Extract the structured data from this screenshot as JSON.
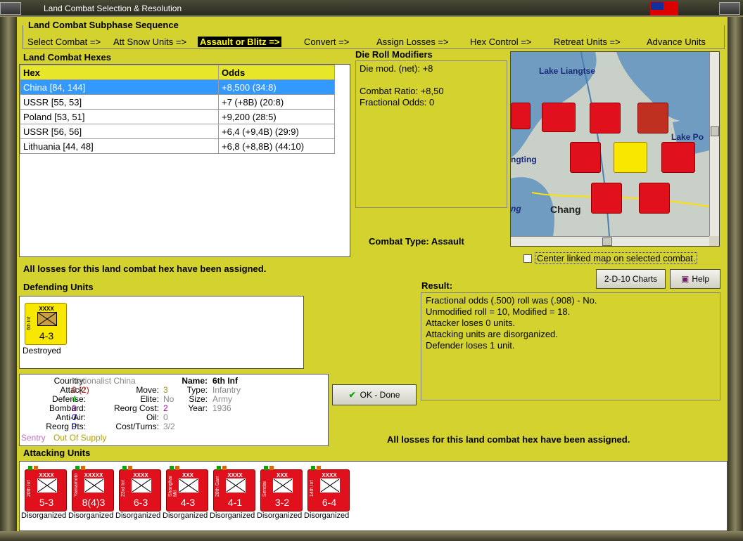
{
  "window": {
    "title": "Land Combat Selection & Resolution"
  },
  "phase": {
    "heading": "Land Combat Subphase Sequence",
    "steps": [
      "Select Combat =>",
      "Att Snow Units =>",
      "Assault or Blitz =>",
      "Convert =>",
      "Assign Losses =>",
      "Hex Control =>",
      "Retreat Units =>",
      "Advance Units"
    ]
  },
  "hexes": {
    "heading": "Land Combat Hexes",
    "col_hex": "Hex",
    "col_odds": "Odds",
    "rows": [
      {
        "hex": "China [84, 144]",
        "odds": "+8,500 (34:8)"
      },
      {
        "hex": "USSR [55, 53]",
        "odds": "+7 (+8B) (20:8)"
      },
      {
        "hex": "Poland [53, 51]",
        "odds": "+9,200 (28:5)"
      },
      {
        "hex": "USSR [56, 56]",
        "odds": "+6,4 (+9,4B) (29:9)"
      },
      {
        "hex": "Lithuania [44, 48]",
        "odds": "+6,8 (+8,8B) (44:10)"
      }
    ]
  },
  "modifiers": {
    "heading": "Die Roll Modifiers",
    "lines": [
      "Die mod. (net): +8",
      "",
      "Combat Ratio: +8,50",
      "Fractional Odds: 0"
    ]
  },
  "map": {
    "labels": [
      "Lake Liangtse",
      "Lake Po",
      "ngting",
      "Chang",
      "ng"
    ],
    "center_label": "Center linked map on selected combat."
  },
  "combat_type": {
    "label": "Combat Type:",
    "value": "Assault"
  },
  "messages": {
    "losses_assigned": "All losses for this land combat hex have been assigned."
  },
  "buttons": {
    "charts": "2-D-10 Charts",
    "help": "Help",
    "ok": "OK - Done"
  },
  "result": {
    "heading": "Result:",
    "lines": [
      "Fractional odds (.500) roll was (.908)  -  No.",
      "Unmodified roll = 10, Modified = 18.",
      "Attacker loses 0 units.",
      "Attacking units are disorganized.",
      "Defender loses 1 unit."
    ]
  },
  "defending": {
    "heading": "Defending Units",
    "unit": {
      "size": "XXXX",
      "name": "6th Inf",
      "value": "4-3",
      "status": "Destroyed"
    }
  },
  "details": {
    "country_l": "Country:",
    "country": "Nationalist China",
    "attack_l": "Attack:",
    "attack": "0",
    "attack2": "(2)",
    "defense_l": "Defense:",
    "defense": "4",
    "bombard_l": "Bombard:",
    "bombard": "0",
    "antiair_l": "Anti-Air:",
    "antiair": "0",
    "reorg_l": "Reorg Pts:",
    "reorg": "0",
    "move_l": "Move:",
    "move": "3",
    "elite_l": "Elite:",
    "elite": "No",
    "reorgcost_l": "Reorg Cost:",
    "reorgcost": "2",
    "oil_l": "Oil:",
    "oil": "0",
    "cost_l": "Cost/Turns:",
    "cost": "3/2",
    "name_l": "Name:",
    "name": "6th Inf",
    "type_l": "Type:",
    "type": "Infantry",
    "size_l": "Size:",
    "size": "Army",
    "year_l": "Year:",
    "year": "1936",
    "sentry": "Sentry",
    "supply": "Out Of Supply"
  },
  "attacking": {
    "heading": "Attacking Units",
    "units": [
      {
        "size": "XXXX",
        "name": "20th Inf",
        "value": "5-3",
        "status": "Disorganized"
      },
      {
        "size": "XXXXX",
        "name": "Yamamoto",
        "value": "8(4)3",
        "status": "Disorganized"
      },
      {
        "size": "XXXX",
        "name": "23rd Inf",
        "value": "6-3",
        "status": "Disorganized"
      },
      {
        "size": "XXX",
        "name": "Shanghai Mil",
        "value": "4-3",
        "status": "Disorganized"
      },
      {
        "size": "XXXX",
        "name": "28th Garr",
        "value": "4-1",
        "status": "Disorganized"
      },
      {
        "size": "XXX",
        "name": "Sendai",
        "value": "3-2",
        "status": "Disorganized"
      },
      {
        "size": "XXXX",
        "name": "14th Inf",
        "value": "6-4",
        "status": "Disorganized"
      }
    ]
  },
  "colors": {
    "accent": "#d4d22e",
    "unit_red": "#e0101c",
    "selection": "#3399ff"
  }
}
